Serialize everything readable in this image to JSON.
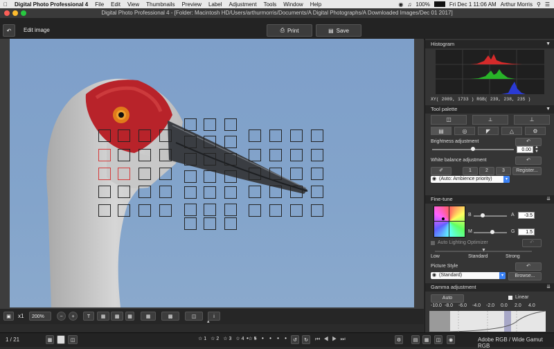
{
  "menubar": {
    "app_name": "Digital Photo Professional 4",
    "items": [
      "File",
      "Edit",
      "View",
      "Thumbnails",
      "Preview",
      "Label",
      "Adjustment",
      "Tools",
      "Window",
      "Help"
    ],
    "battery": "100%",
    "datetime": "Fri Dec 1  11:06 AM",
    "user": "Arthur Morris"
  },
  "titlebar": {
    "title": "Digital Photo Professional 4 - [Folder: Macintosh HD/Users/arthurmorris/Documents/A Digital Photographs/A Downloaded Images/Dec 01 2017]"
  },
  "toolbar": {
    "mode_label": "Edit image",
    "print_label": "Print",
    "save_label": "Save"
  },
  "histogram": {
    "title": "Histogram",
    "readout": "XY(  2089,   1733 ) RGB( 239,  238,  235 )"
  },
  "tool_palette": {
    "title": "Tool palette",
    "brightness": {
      "label": "Brightness adjustment",
      "value": "0.00",
      "level": 0.5
    },
    "white_balance": {
      "label": "White balance adjustment",
      "presets": [
        "1",
        "2",
        "3"
      ],
      "register_label": "Register...",
      "selected": "(Auto: Ambience priority)"
    }
  },
  "fine_tune": {
    "title": "Fine-tune",
    "b_label": "B",
    "a_label": "A",
    "a_value": "-3.5",
    "m_label": "M",
    "g_label": "G",
    "g_value": "1.5",
    "b_level": 0.27,
    "m_level": 0.57,
    "alo_label": "Auto Lighting Optimizer",
    "alo_levels": [
      "Low",
      "Standard",
      "Strong"
    ],
    "alo_level": 0.5,
    "picture_style_label": "Picture Style",
    "picture_style_value": "(Standard)",
    "browse_label": "Browse..."
  },
  "gamma": {
    "title": "Gamma adjustment",
    "auto_label": "Auto",
    "linear_label": "Linear",
    "scale": [
      "-10.0",
      "-8.0",
      "-6.0",
      "-4.0",
      "-2.0",
      "0.0",
      "2.0",
      "4.0"
    ]
  },
  "view_bar": {
    "x1_label": "x1",
    "zoom": "200%"
  },
  "status": {
    "page": "1 / 21",
    "color_space": "Adobe RGB / Wide Gamut RGB"
  },
  "colors": {
    "af_point_active": "#d43a3a",
    "accent_blue": "#3b82f6"
  }
}
